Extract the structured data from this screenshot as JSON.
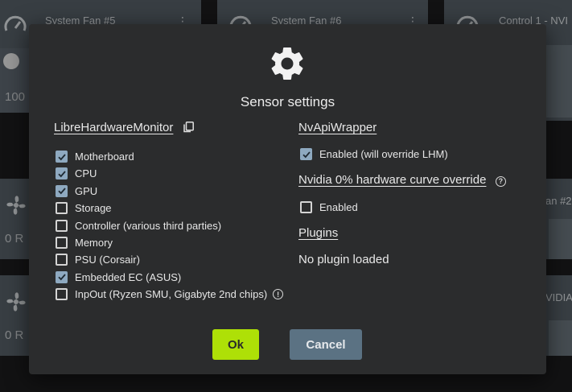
{
  "background_cards": {
    "fan5": {
      "title": "System Fan #5",
      "value": "100"
    },
    "fan6": {
      "title": "System Fan #6"
    },
    "control1": {
      "title": "Control 1 - NVI"
    },
    "left_mid": {
      "value": "0 R"
    },
    "right_mid": {
      "title": "an #2"
    },
    "left_bottom": {
      "value": "0 R"
    },
    "right_bottom": {
      "title": "VIDIA"
    }
  },
  "dialog": {
    "title": "Sensor settings",
    "lhm": {
      "heading": "LibreHardwareMonitor",
      "options": [
        {
          "label": "Motherboard",
          "checked": true
        },
        {
          "label": "CPU",
          "checked": true
        },
        {
          "label": "GPU",
          "checked": true
        },
        {
          "label": "Storage",
          "checked": false
        },
        {
          "label": "Controller (various third parties)",
          "checked": false
        },
        {
          "label": "Memory",
          "checked": false
        },
        {
          "label": "PSU (Corsair)",
          "checked": false
        },
        {
          "label": "Embedded EC (ASUS)",
          "checked": true
        },
        {
          "label": "InpOut (Ryzen SMU, Gigabyte 2nd chips)",
          "checked": false
        }
      ]
    },
    "nvapi": {
      "heading": "NvApiWrapper",
      "enabled_label": "Enabled (will override LHM)",
      "enabled_checked": true
    },
    "nvidia_curve": {
      "heading": "Nvidia 0% hardware curve override",
      "enabled_label": "Enabled",
      "enabled_checked": false
    },
    "plugins": {
      "heading": "Plugins",
      "status": "No plugin loaded"
    },
    "buttons": {
      "ok": "Ok",
      "cancel": "Cancel"
    }
  },
  "colors": {
    "accent": "#aee007",
    "cancel": "#5b7283",
    "checkbox_on": "#8ea9c0",
    "dialog_bg": "#2b2c2d"
  }
}
